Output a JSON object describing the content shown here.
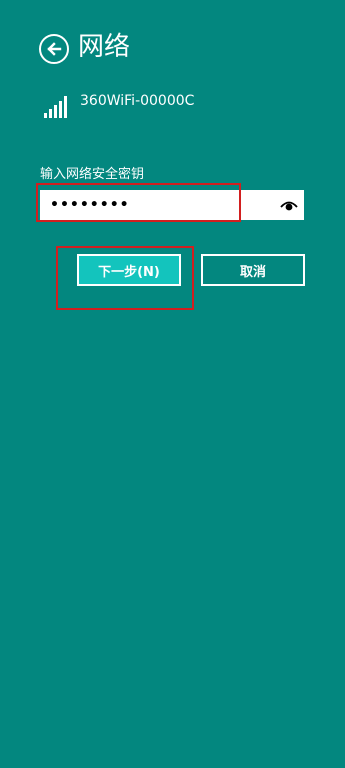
{
  "header": {
    "back_icon": "arrow-left-circle-icon",
    "title": "网络"
  },
  "network": {
    "signal_icon": "wifi-signal-bars-icon",
    "ssid": "360WiFi-00000C"
  },
  "password": {
    "label": "输入网络安全密钥",
    "value": "••••••••",
    "reveal_icon": "eye-reveal-icon"
  },
  "buttons": {
    "next_label": "下一步(N)",
    "cancel_label": "取消"
  },
  "colors": {
    "background": "#03877f",
    "primary_button": "#13c4bd",
    "highlight_outline": "#d21f1f"
  }
}
